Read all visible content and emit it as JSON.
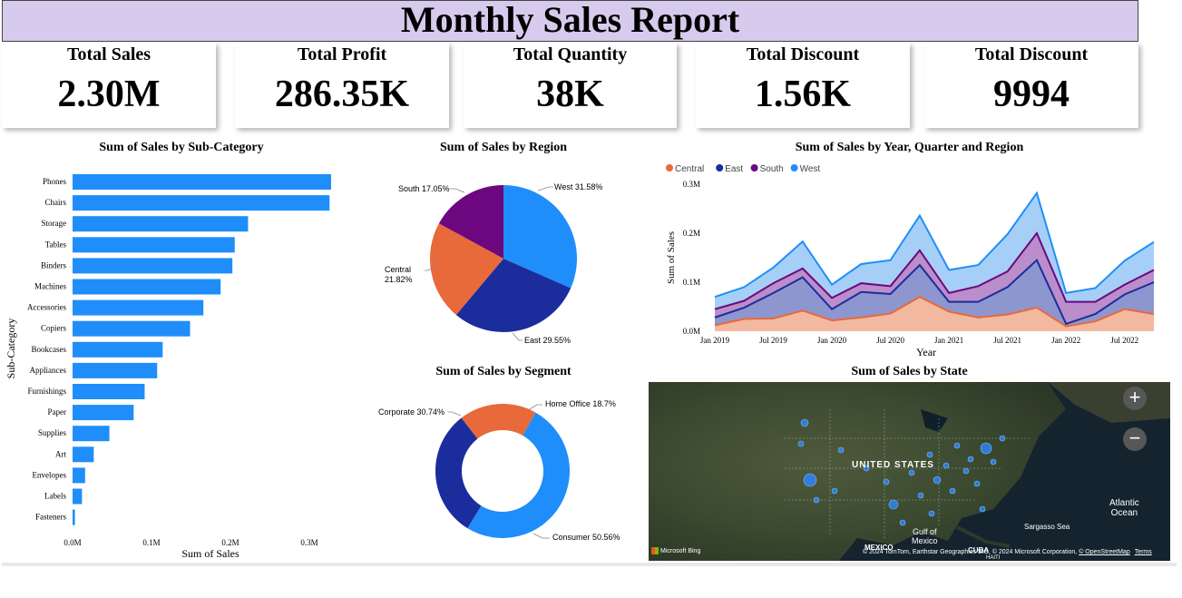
{
  "title": "Monthly Sales Report",
  "kpis": [
    {
      "label": "Total Sales",
      "value": "2.30M"
    },
    {
      "label": "Total Profit",
      "value": "286.35K"
    },
    {
      "label": "Total Quantity",
      "value": "38K"
    },
    {
      "label": "Total Discount",
      "value": "1.56K"
    },
    {
      "label": "Total Discount",
      "value": "9994"
    }
  ],
  "colors": {
    "central": "#e8693a",
    "east": "#1b2d9c",
    "south": "#6c077f",
    "west": "#1f8efa",
    "title_bg": "#d6cbed"
  },
  "map": {
    "title": "Sum of Sales by State",
    "labels": {
      "country": "UNITED STATES",
      "gulf": "Gulf of\nMexico",
      "ocean": "Atlantic\nOcean",
      "sea": "Sargasso Sea",
      "mexico": "MEXICO",
      "cuba": "CUBA",
      "haiti": "HAITI"
    },
    "bing": "Microsoft Bing",
    "attribution": "© 2024 TomTom, Earthstar Geographics SIO, © 2024 Microsoft Corporation,",
    "osm": "© OpenStreetMap",
    "terms": "Terms",
    "zoom_in": "+",
    "zoom_out": "−"
  },
  "chart_data": [
    {
      "type": "bar",
      "title": "Sum of Sales by Sub-Category",
      "xlabel": "Sum of Sales",
      "ylabel": "Sub-Category",
      "categories": [
        "Phones",
        "Chairs",
        "Storage",
        "Tables",
        "Binders",
        "Machines",
        "Accessories",
        "Copiers",
        "Bookcases",
        "Appliances",
        "Furnishings",
        "Paper",
        "Supplies",
        "Art",
        "Envelopes",
        "Labels",
        "Fasteners"
      ],
      "values": [
        330000,
        328000,
        224000,
        207000,
        204000,
        189000,
        167000,
        150000,
        115000,
        108000,
        92000,
        78000,
        47000,
        27000,
        16000,
        12000,
        3000
      ],
      "xticks": [
        "0.0M",
        "0.1M",
        "0.2M",
        "0.3M"
      ],
      "xlim": [
        0,
        0.35
      ],
      "color": "#1f8efa"
    },
    {
      "type": "pie",
      "title": "Sum of Sales by Region",
      "slices": [
        {
          "name": "West",
          "value": 31.58,
          "label": "West 31.58%",
          "color": "#1f8efa"
        },
        {
          "name": "East",
          "value": 29.55,
          "label": "East 29.55%",
          "color": "#1b2d9c"
        },
        {
          "name": "Central",
          "value": 21.82,
          "label": "Central\n21.82%",
          "color": "#e8693a"
        },
        {
          "name": "South",
          "value": 17.05,
          "label": "South 17.05%",
          "color": "#6c077f"
        }
      ]
    },
    {
      "type": "pie",
      "title": "Sum of Sales by Segment",
      "donut": true,
      "slices": [
        {
          "name": "Consumer",
          "value": 50.56,
          "label": "Consumer 50.56%",
          "color": "#1f8efa"
        },
        {
          "name": "Corporate",
          "value": 30.74,
          "label": "Corporate 30.74%",
          "color": "#1b2d9c"
        },
        {
          "name": "Home Office",
          "value": 18.7,
          "label": "Home Office 18.7%",
          "color": "#e8693a"
        }
      ]
    },
    {
      "type": "area",
      "title": "Sum of Sales by Year, Quarter and Region",
      "xlabel": "Year",
      "ylabel": "Sum of Sales",
      "xticks": [
        "Jan 2019",
        "Jul 2019",
        "Jan 2020",
        "Jul 2020",
        "Jan 2021",
        "Jul 2021",
        "Jan 2022",
        "Jul 2022"
      ],
      "yticks": [
        "0.0M",
        "0.1M",
        "0.2M",
        "0.3M"
      ],
      "ylim": [
        0,
        0.3
      ],
      "stacked": true,
      "legend": "top-left",
      "series": [
        {
          "name": "Central",
          "color": "#e8693a",
          "values": [
            0.012,
            0.025,
            0.026,
            0.042,
            0.022,
            0.028,
            0.036,
            0.07,
            0.04,
            0.028,
            0.034,
            0.048,
            0.01,
            0.02,
            0.045,
            0.035
          ]
        },
        {
          "name": "East",
          "color": "#1b2d9c",
          "values": [
            0.028,
            0.048,
            0.078,
            0.11,
            0.045,
            0.08,
            0.076,
            0.135,
            0.06,
            0.06,
            0.09,
            0.145,
            0.015,
            0.035,
            0.075,
            0.1
          ]
        },
        {
          "name": "South",
          "color": "#6c077f",
          "values": [
            0.045,
            0.062,
            0.098,
            0.128,
            0.068,
            0.098,
            0.092,
            0.165,
            0.078,
            0.092,
            0.122,
            0.2,
            0.06,
            0.06,
            0.095,
            0.125
          ]
        },
        {
          "name": "West",
          "color": "#1f8efa",
          "values": [
            0.07,
            0.09,
            0.13,
            0.183,
            0.095,
            0.137,
            0.145,
            0.236,
            0.125,
            0.135,
            0.198,
            0.282,
            0.078,
            0.088,
            0.144,
            0.182
          ]
        }
      ]
    }
  ]
}
